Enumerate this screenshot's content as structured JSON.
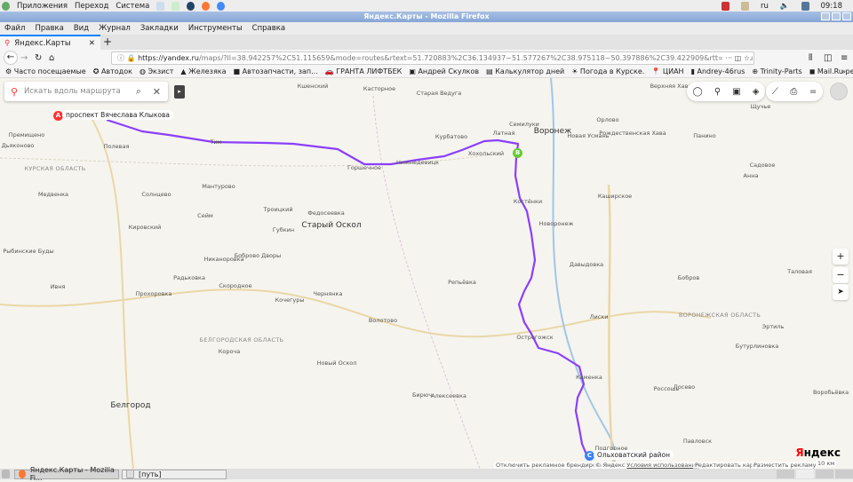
{
  "system": {
    "menus": [
      "Приложения",
      "Переход",
      "Система"
    ],
    "lang": "ru",
    "clock": "09:18"
  },
  "window": {
    "title": "Яндекс.Карты - Mozilla Firefox"
  },
  "menubar": [
    "Файл",
    "Правка",
    "Вид",
    "Журнал",
    "Закладки",
    "Инструменты",
    "Справка"
  ],
  "tab": {
    "label": "Яндекс.Карты",
    "close": "✕",
    "new": "+"
  },
  "url": {
    "host": "https://yandex.ru",
    "path": "/maps/?ll=38.942257%2C51.115659&mode=routes&rtext=51.720883%2C36.134937~51.577267%2C38.975118~50.397886%2C39.422909&rtt=auto&ruri=~"
  },
  "bookmarks": [
    "Часто посещаемые",
    "Автодок",
    "Экзист",
    "Железяка",
    "Автозапчасти, зап...",
    "ГРАНТА ЛИФТБЕК",
    "Андрей Скулков",
    "Калькулятор дней",
    "Погода в Курске.",
    "ЦИАН",
    "Andrey-46rus",
    "Trinity-Parts",
    "Mail.Ru рекоменду..."
  ],
  "map": {
    "search_placeholder": "Искать вдоль маршрута",
    "route_color": "#8a3ffc",
    "waypoints": [
      {
        "letter": "A",
        "label": "проспект Вячеслава Клыкова",
        "color": "#f33"
      },
      {
        "letter": "B",
        "color": "#6c3"
      },
      {
        "letter": "C",
        "label": "Ольховатский район",
        "color": "#3b82f6"
      }
    ],
    "labels": [
      "Кшенский",
      "Касторное",
      "Старая Ведуга",
      "Семилуки",
      "Воронеж",
      "Орлово",
      "Новая Усмань",
      "Рождественская Хава",
      "Панино",
      "Верхняя Хава",
      "Щучье",
      "Курбатово",
      "Латная",
      "Хохольский",
      "Нижнедевицк",
      "Горшечное",
      "Тим",
      "Полевая",
      "Премищено",
      "Дьяконово",
      "КУРСКАЯ ОБЛАСТЬ",
      "Солнцево",
      "Мантурово",
      "Медвенка",
      "Троицкий",
      "Федосеевка",
      "Старый Оскол",
      "Губкин",
      "Сейм",
      "Кировский",
      "Рыбинские Буды",
      "Ивня",
      "Прохоровка",
      "Никаноровка",
      "Боброво Дворы",
      "Скородное",
      "Радьковка",
      "Кочегуры",
      "Чернянка",
      "БЕЛГОРОДСКАЯ ОБЛАСТЬ",
      "Новый Оскол",
      "Волотово",
      "Короча",
      "Белгород",
      "ВОРОНЕЖСКАЯ ОБЛАСТЬ",
      "Лиски",
      "Острогожск",
      "Каменка",
      "Подгорное",
      "Павловск",
      "Бобров",
      "Таловая",
      "Каширское",
      "Давыдовка",
      "Репьёвка",
      "Новоронеж",
      "Костёнки",
      "Алексеевка",
      "Бирюч",
      "Ольховатка",
      "Россошь",
      "Лосево",
      "Воробьёвка",
      "Бутурлиновка",
      "Эртиль",
      "Анна",
      "Садовое"
    ],
    "footer": {
      "ads_off": "Отключить рекламное брендирование",
      "copyright": "© Яндекс",
      "terms": "Условия использования",
      "edit": "Редактировать карту",
      "place_ad": "Разместить рекламу",
      "scale": "10 км"
    },
    "logo": "Яндекс"
  },
  "taskbar": [
    "Яндекс.Карты - Mozilla Fi...",
    "[путь]"
  ]
}
